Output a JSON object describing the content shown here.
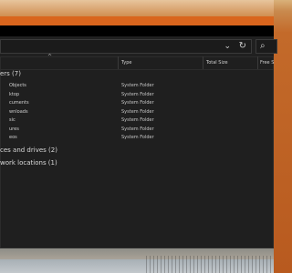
{
  "address_bar": {
    "chevron_icon": "chevron-down-icon",
    "refresh_icon": "refresh-icon"
  },
  "search": {
    "icon": "search-icon"
  },
  "columns": {
    "type": "Type",
    "total_size": "Total Size",
    "free_space": "Free S"
  },
  "groups": [
    {
      "label": "ers (7)",
      "items": [
        {
          "name": "Objects",
          "type": "System Folder"
        },
        {
          "name": "ktop",
          "type": "System Folder"
        },
        {
          "name": "cuments",
          "type": "System Folder"
        },
        {
          "name": "wnloads",
          "type": "System Folder"
        },
        {
          "name": "sic",
          "type": "System Folder"
        },
        {
          "name": "ures",
          "type": "System Folder"
        },
        {
          "name": "eos",
          "type": "System Folder"
        }
      ]
    },
    {
      "label": "ces and drives (2)"
    },
    {
      "label": "work locations (1)"
    }
  ],
  "colors": {
    "window_bg": "#1f1f1f",
    "titlebar": "#000000",
    "desktop_orange": "#d9651d"
  }
}
